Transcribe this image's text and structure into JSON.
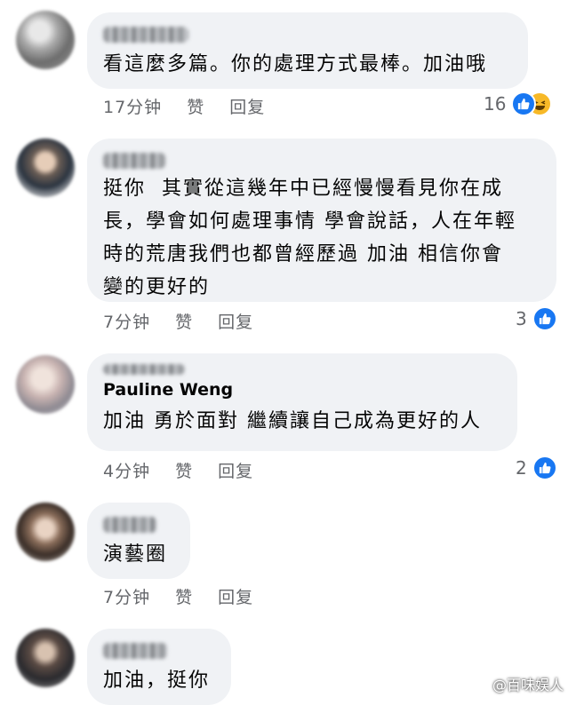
{
  "comments": [
    {
      "text": "看這麼多篇。你的處理方式最棒。加油哦",
      "time": "17分钟",
      "like_label": "赞",
      "reply_label": "回复",
      "reaction_count": "16",
      "reactions": [
        "like-icon",
        "haha-icon"
      ]
    },
    {
      "text": "挺你  其實從這幾年中已經慢慢看見你在成\n長，學會如何處理事情 學會說話，人在年輕\n時的荒唐我們也都曾經歷過 加油 相信你會\n變的更好的",
      "time": "7分钟",
      "like_label": "赞",
      "reply_label": "回复",
      "reaction_count": "3",
      "reactions": [
        "like-icon"
      ]
    },
    {
      "name": "Pauline Weng",
      "text": "加油 勇於面對 繼續讓自己成為更好的人",
      "time": "4分钟",
      "like_label": "赞",
      "reply_label": "回复",
      "reaction_count": "2",
      "reactions": [
        "like-icon"
      ]
    },
    {
      "text": "演藝圈",
      "time": "7分钟",
      "like_label": "赞",
      "reply_label": "回复"
    },
    {
      "text": "加油，挺你"
    }
  ],
  "watermark": {
    "text": "@百味娱人"
  },
  "colors": {
    "bubble": "#f0f2f5",
    "meta_text": "#65676b",
    "like_blue": "#1877f2",
    "haha_yellow": "#f7b928"
  }
}
